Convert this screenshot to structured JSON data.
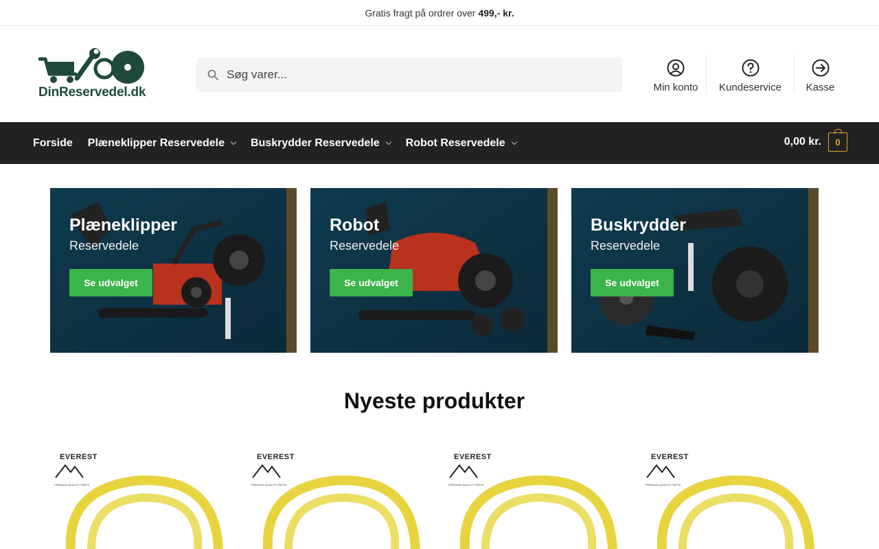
{
  "topbar": {
    "text": "Gratis fragt på ordrer over",
    "highlight": "499,- kr."
  },
  "logo": {
    "text": "DinReservedel.dk"
  },
  "search": {
    "placeholder": "Søg varer..."
  },
  "header_links": [
    {
      "label": "Min konto",
      "icon": "user-circle-icon"
    },
    {
      "label": "Kundeservice",
      "icon": "help-circle-icon"
    },
    {
      "label": "Kasse",
      "icon": "arrow-right-circle-icon"
    }
  ],
  "nav": {
    "items": [
      {
        "label": "Forside",
        "has_dropdown": false
      },
      {
        "label": "Plæneklipper Reservedele",
        "has_dropdown": true
      },
      {
        "label": "Buskrydder Reservedele",
        "has_dropdown": true
      },
      {
        "label": "Robot Reservedele",
        "has_dropdown": true
      }
    ],
    "cart_total": "0,00 kr.",
    "cart_count": "0"
  },
  "banners": [
    {
      "title": "Plæneklipper",
      "subtitle": "Reservedele",
      "button": "Se udvalget"
    },
    {
      "title": "Robot",
      "subtitle": "Reservedele",
      "button": "Se udvalget"
    },
    {
      "title": "Buskrydder",
      "subtitle": "Reservedele",
      "button": "Se udvalget"
    }
  ],
  "section_title": "Nyeste produkter",
  "products": [
    {
      "brand": "EVEREST",
      "tag": "PREMIUM QUALITY PARTS"
    },
    {
      "brand": "EVEREST",
      "tag": "PREMIUM QUALITY PARTS"
    },
    {
      "brand": "EVEREST",
      "tag": "PREMIUM QUALITY PARTS"
    },
    {
      "brand": "EVEREST",
      "tag": "PREMIUM QUALITY PARTS"
    }
  ],
  "colors": {
    "accent_green": "#3bb44a",
    "nav_bg": "#222222",
    "cart_accent": "#e0a32e",
    "logo_green": "#1f4a3b"
  }
}
